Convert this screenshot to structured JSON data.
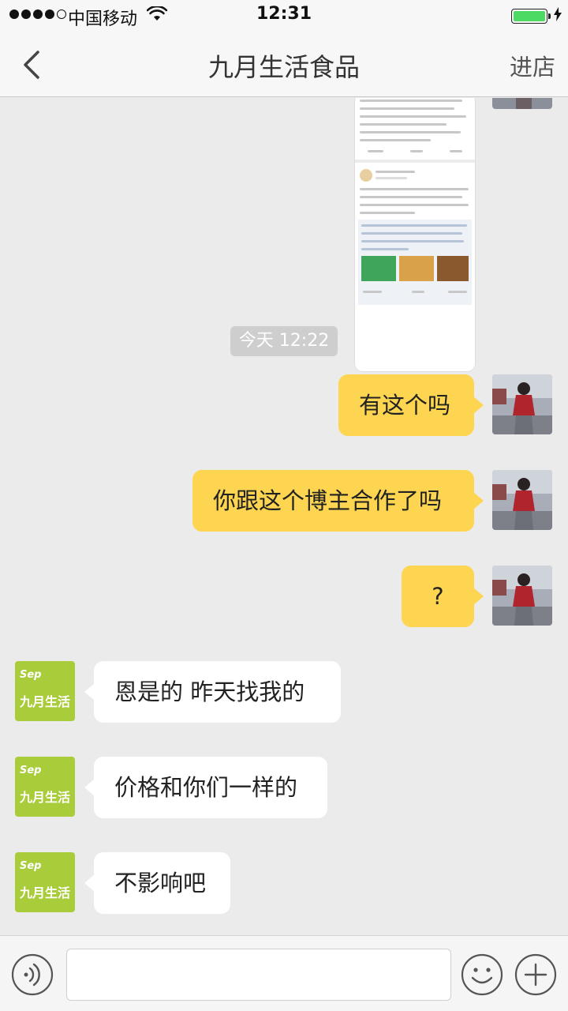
{
  "status_bar": {
    "carrier": "中国移动",
    "time": "12:31"
  },
  "nav": {
    "title": "九月生活食品",
    "right_label": "进店"
  },
  "timestamp": "今天 12:22",
  "messages": [
    {
      "side": "right",
      "text": "有这个吗"
    },
    {
      "side": "right",
      "text": "你跟这个博主合作了吗"
    },
    {
      "side": "right",
      "text": "?"
    },
    {
      "side": "left",
      "text": "恩是的 昨天找我的"
    },
    {
      "side": "left",
      "text": "价格和你们一样的"
    },
    {
      "side": "left",
      "text": "不影响吧"
    }
  ],
  "shop_logo": {
    "sep": "Sep",
    "name": "九月生活"
  },
  "input": {
    "placeholder": ""
  },
  "colors": {
    "self_bubble": "#fdd550",
    "other_bubble": "#ffffff",
    "logo_green": "#a9cc3a"
  }
}
